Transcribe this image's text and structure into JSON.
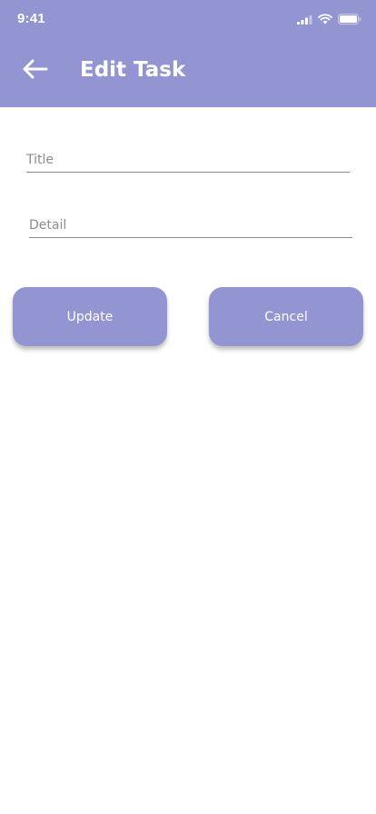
{
  "status_bar": {
    "time": "9:41",
    "icons": [
      "cellular-signal-icon",
      "wifi-icon",
      "battery-icon"
    ]
  },
  "header": {
    "title": "Edit Task",
    "back_icon": "arrow-left-icon",
    "background": "#9395d3"
  },
  "form": {
    "title_field": {
      "placeholder": "Title",
      "value": ""
    },
    "detail_field": {
      "placeholder": "Detail",
      "value": ""
    }
  },
  "actions": {
    "update_label": "Update",
    "cancel_label": "Cancel",
    "button_color": "#9395d3"
  }
}
